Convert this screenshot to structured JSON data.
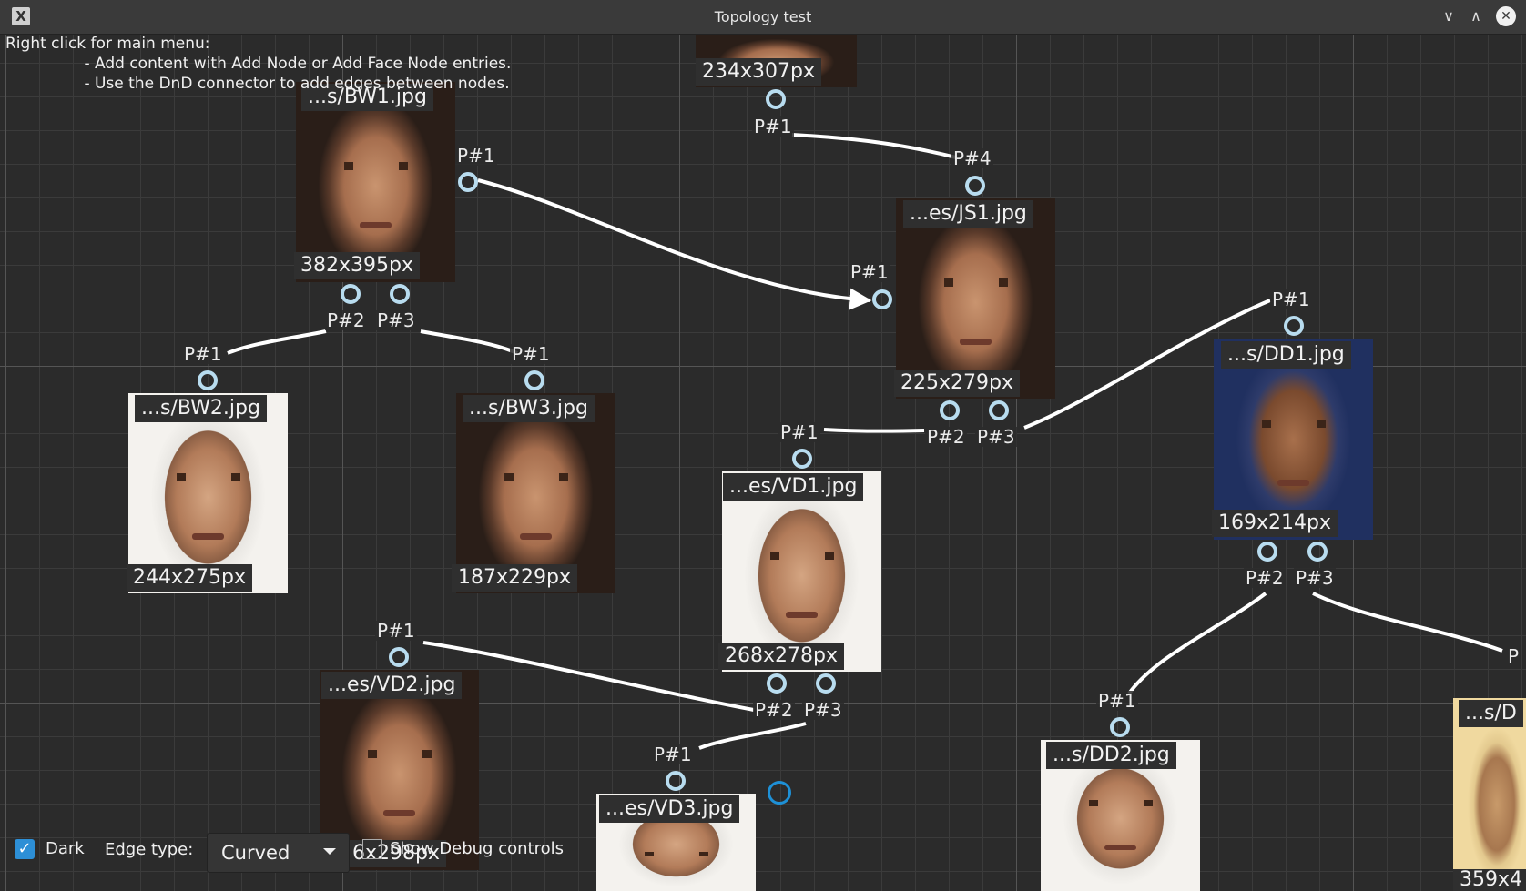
{
  "window": {
    "title": "Topology test",
    "buttons": {
      "minimize": "∨",
      "maximize": "∧",
      "close": "✕"
    }
  },
  "help": {
    "line1": "Right click for main menu:",
    "line2": "                - Add content with Add Node or Add Face Node entries.",
    "line3": "                - Use the DnD connector to add edges between nodes."
  },
  "nodes": [
    {
      "id": "top",
      "title": "",
      "size": "234x307px"
    },
    {
      "id": "bw1",
      "title": "...s/BW1.jpg",
      "size": "382x395px"
    },
    {
      "id": "js1",
      "title": "...es/JS1.jpg",
      "size": "225x279px"
    },
    {
      "id": "bw2",
      "title": "...s/BW2.jpg",
      "size": "244x275px"
    },
    {
      "id": "bw3",
      "title": "...s/BW3.jpg",
      "size": "187x229px"
    },
    {
      "id": "vd1",
      "title": "...es/VD1.jpg",
      "size": "268x278px"
    },
    {
      "id": "dd1",
      "title": "...s/DD1.jpg",
      "size": "169x214px"
    },
    {
      "id": "vd2",
      "title": "...es/VD2.jpg",
      "size": "6x298px"
    },
    {
      "id": "vd3",
      "title": "...es/VD3.jpg",
      "size": ""
    },
    {
      "id": "dd2",
      "title": "...s/DD2.jpg",
      "size": ""
    },
    {
      "id": "dd3",
      "title": "...s/D",
      "size": "359x4"
    }
  ],
  "ports": {
    "p1": "P#1",
    "p2": "P#2",
    "p3": "P#3",
    "p4": "P#4",
    "p_cut": "P"
  },
  "controls": {
    "dark_label": "Dark",
    "dark_checked": true,
    "edge_type_label": "Edge type:",
    "edge_type_value": "Curved",
    "debug_label": "Show Debug controls"
  },
  "colors": {
    "background": "#2b2b2b",
    "port": "#b8dcef",
    "edge": "#ffffff",
    "accent": "#2d8fd6"
  }
}
